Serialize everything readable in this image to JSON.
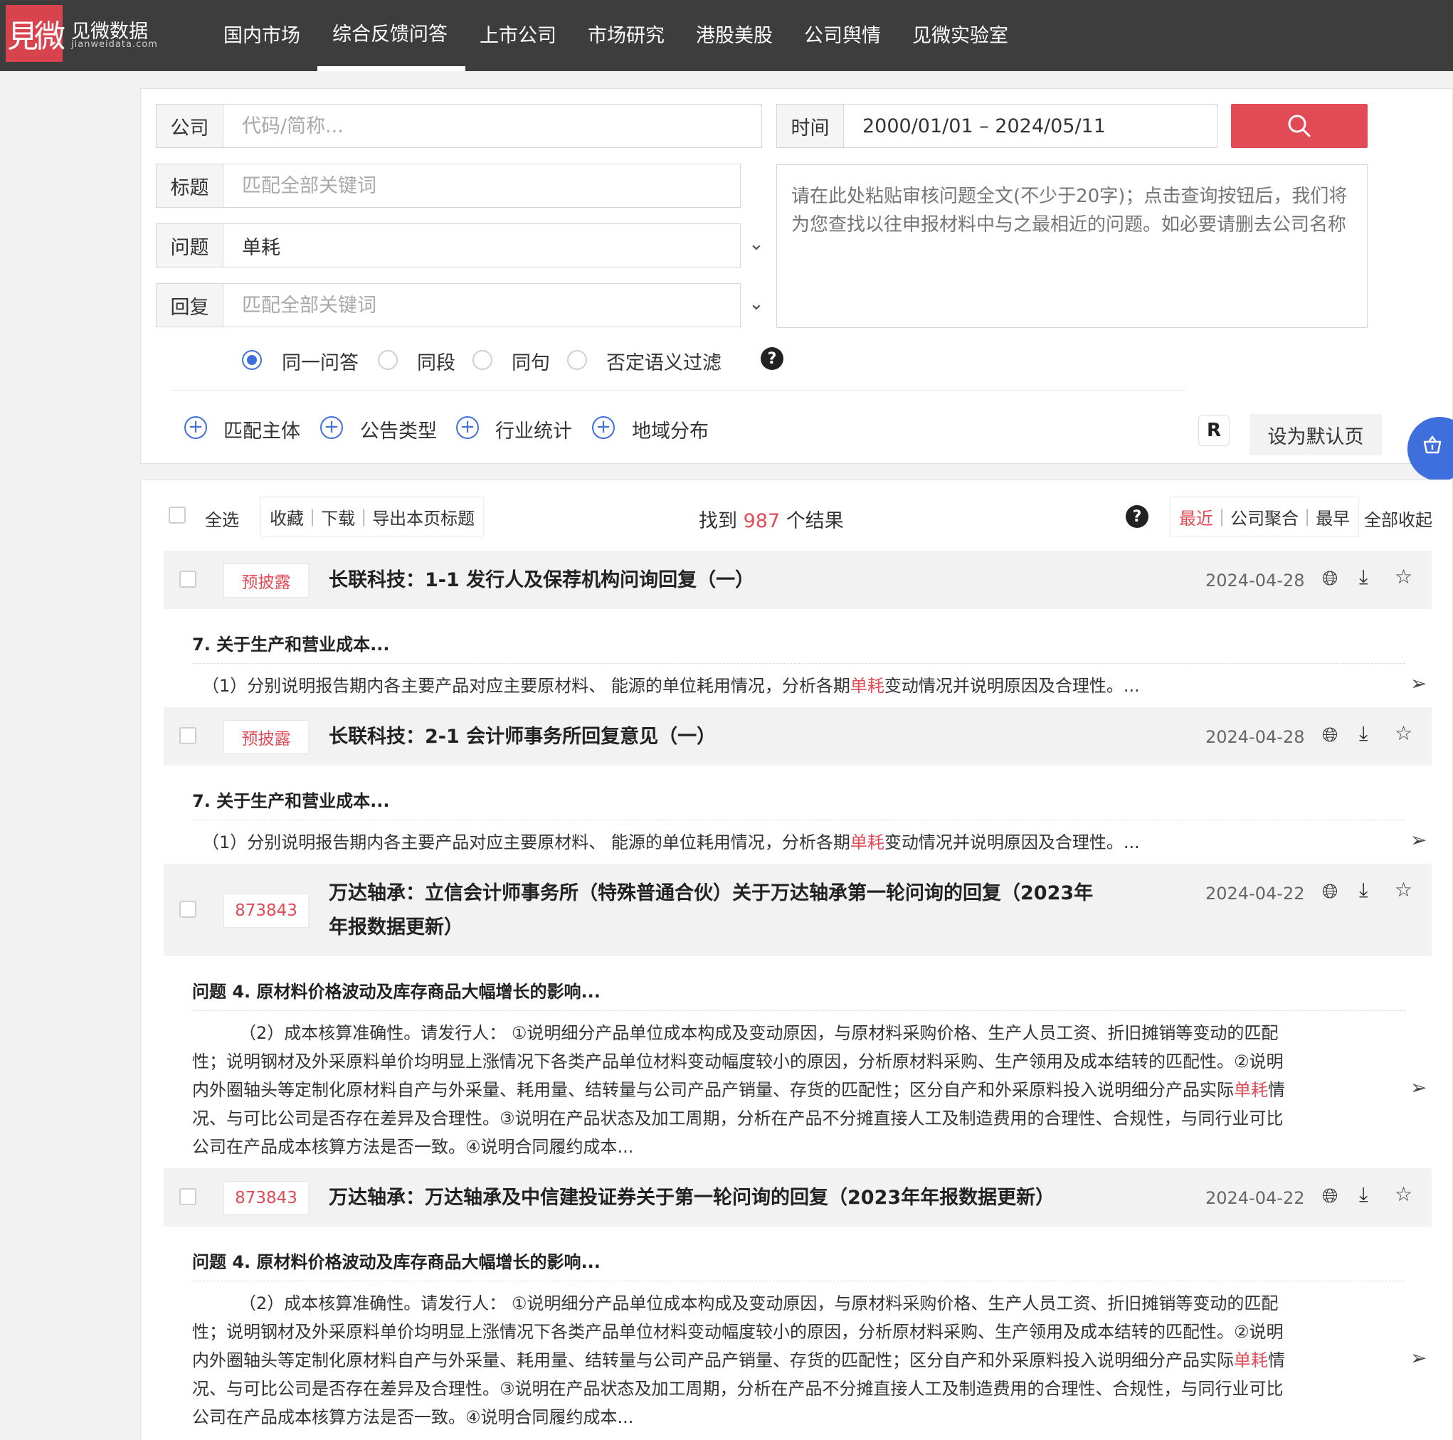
{
  "nav": {
    "logo_mark": "見微",
    "logo_name": "见微数据",
    "logo_url": "jianweidata.com",
    "items": [
      "国内市场",
      "综合反馈问答",
      "上市公司",
      "市场研究",
      "港股美股",
      "公司舆情",
      "见微实验室"
    ],
    "active_index": 1
  },
  "search": {
    "company_label": "公司",
    "company_placeholder": "代码/简称...",
    "time_label": "时间",
    "time_value": "2000/01/01 – 2024/05/11",
    "title_label": "标题",
    "title_placeholder": "匹配全部关键词",
    "question_label": "问题",
    "question_value": "单耗",
    "reply_label": "回复",
    "reply_placeholder": "匹配全部关键词",
    "textarea_placeholder": "请在此处粘贴审核问题全文(不少于20字)；点击查询按钮后，我们将为您查找以往申报材料中与之最相近的问题。如必要请删去公司名称",
    "radios": [
      "同一问答",
      "同段",
      "同句",
      "否定语义过滤"
    ],
    "radio_selected": 0,
    "filters": [
      "匹配主体",
      "公告类型",
      "行业统计",
      "地域分布"
    ],
    "r_icon": "R",
    "default_page_btn": "设为默认页",
    "help_glyph": "?"
  },
  "results": {
    "select_all": "全选",
    "actions": [
      "收藏",
      "下载",
      "导出本页标题"
    ],
    "count_prefix": "找到",
    "count": "987",
    "count_suffix": "个结果",
    "sort": [
      "最近",
      "公司聚合",
      "最早"
    ],
    "sort_active": 0,
    "collapse_all": "全部收起",
    "items": [
      {
        "tag": "预披露",
        "title": "长联科技：1-1 发行人及保荐机构问询回复（一）",
        "date": "2024-04-28",
        "qhead": "7. 关于生产和营业成本...",
        "body_before": "（1）分别说明报告期内各主要产品对应主要原材料、 能源的单位耗用情况，分析各期",
        "body_hl": "单耗",
        "body_after": "变动情况并说明原因及合理性。..."
      },
      {
        "tag": "预披露",
        "title": "长联科技：2-1 会计师事务所回复意见（一）",
        "date": "2024-04-28",
        "qhead": "7. 关于生产和营业成本...",
        "body_before": "（1）分别说明报告期内各主要产品对应主要原材料、 能源的单位耗用情况，分析各期",
        "body_hl": "单耗",
        "body_after": "变动情况并说明原因及合理性。..."
      },
      {
        "tag": "873843",
        "title_line1": "万达轴承：立信会计师事务所（特殊普通合伙）关于万达轴承第一轮问询的回复（2023年",
        "title_line2": "年报数据更新）",
        "date": "2024-04-22",
        "qhead": "问题 4. 原材料价格波动及库存商品大幅增长的影响...",
        "body_line1": "（2）成本核算准确性。请发行人： ①说明细分产品单位成本构成及变动原因，与原材料采购价格、生产人员工资、折旧摊销等变动的匹配",
        "body_line2": "性；说明钢材及外采原料单价均明显上涨情况下各类产品单位材料变动幅度较小的原因，分析原材料采购、生产领用及成本结转的匹配性。②说明",
        "body_line3_before": "内外圈轴头等定制化原材料自产与外采量、耗用量、结转量与公司产品产销量、存货的匹配性；区分自产和外采原料投入说明细分产品实际",
        "body_line3_hl": "单耗",
        "body_line3_after": "情",
        "body_line4": "况、与可比公司是否存在差异及合理性。③说明在产品状态及加工周期，分析在产品不分摊直接人工及制造费用的合理性、合规性，与同行业可比",
        "body_line5": "公司在产品成本核算方法是否一致。④说明合同履约成本..."
      },
      {
        "tag": "873843",
        "title": "万达轴承：万达轴承及中信建投证券关于第一轮问询的回复（2023年年报数据更新）",
        "date": "2024-04-22",
        "qhead": "问题 4. 原材料价格波动及库存商品大幅增长的影响...",
        "body_line1": "（2）成本核算准确性。请发行人： ①说明细分产品单位成本构成及变动原因，与原材料采购价格、生产人员工资、折旧摊销等变动的匹配",
        "body_line2": "性；说明钢材及外采原料单价均明显上涨情况下各类产品单位材料变动幅度较小的原因，分析原材料采购、生产领用及成本结转的匹配性。②说明",
        "body_line3_before": "内外圈轴头等定制化原材料自产与外采量、耗用量、结转量与公司产品产销量、存货的匹配性；区分自产和外采原料投入说明细分产品实际",
        "body_line3_hl": "单耗",
        "body_line3_after": "情",
        "body_line4": "况、与可比公司是否存在差异及合理性。③说明在产品状态及加工周期，分析在产品不分摊直接人工及制造费用的合理性、合规性，与同行业可比",
        "body_line5": "公司在产品成本核算方法是否一致。④说明合同履约成本..."
      }
    ]
  },
  "colors": {
    "brand": "#d9434d",
    "accent": "#3f6fdc",
    "highlight": "#e24b56",
    "nav_bg": "#3d3d3d"
  },
  "icons": [
    "search-icon",
    "chevron-down-icon",
    "help-icon",
    "plus-circle-icon",
    "globe-icon",
    "download-icon",
    "star-icon",
    "send-icon",
    "basket-icon"
  ]
}
